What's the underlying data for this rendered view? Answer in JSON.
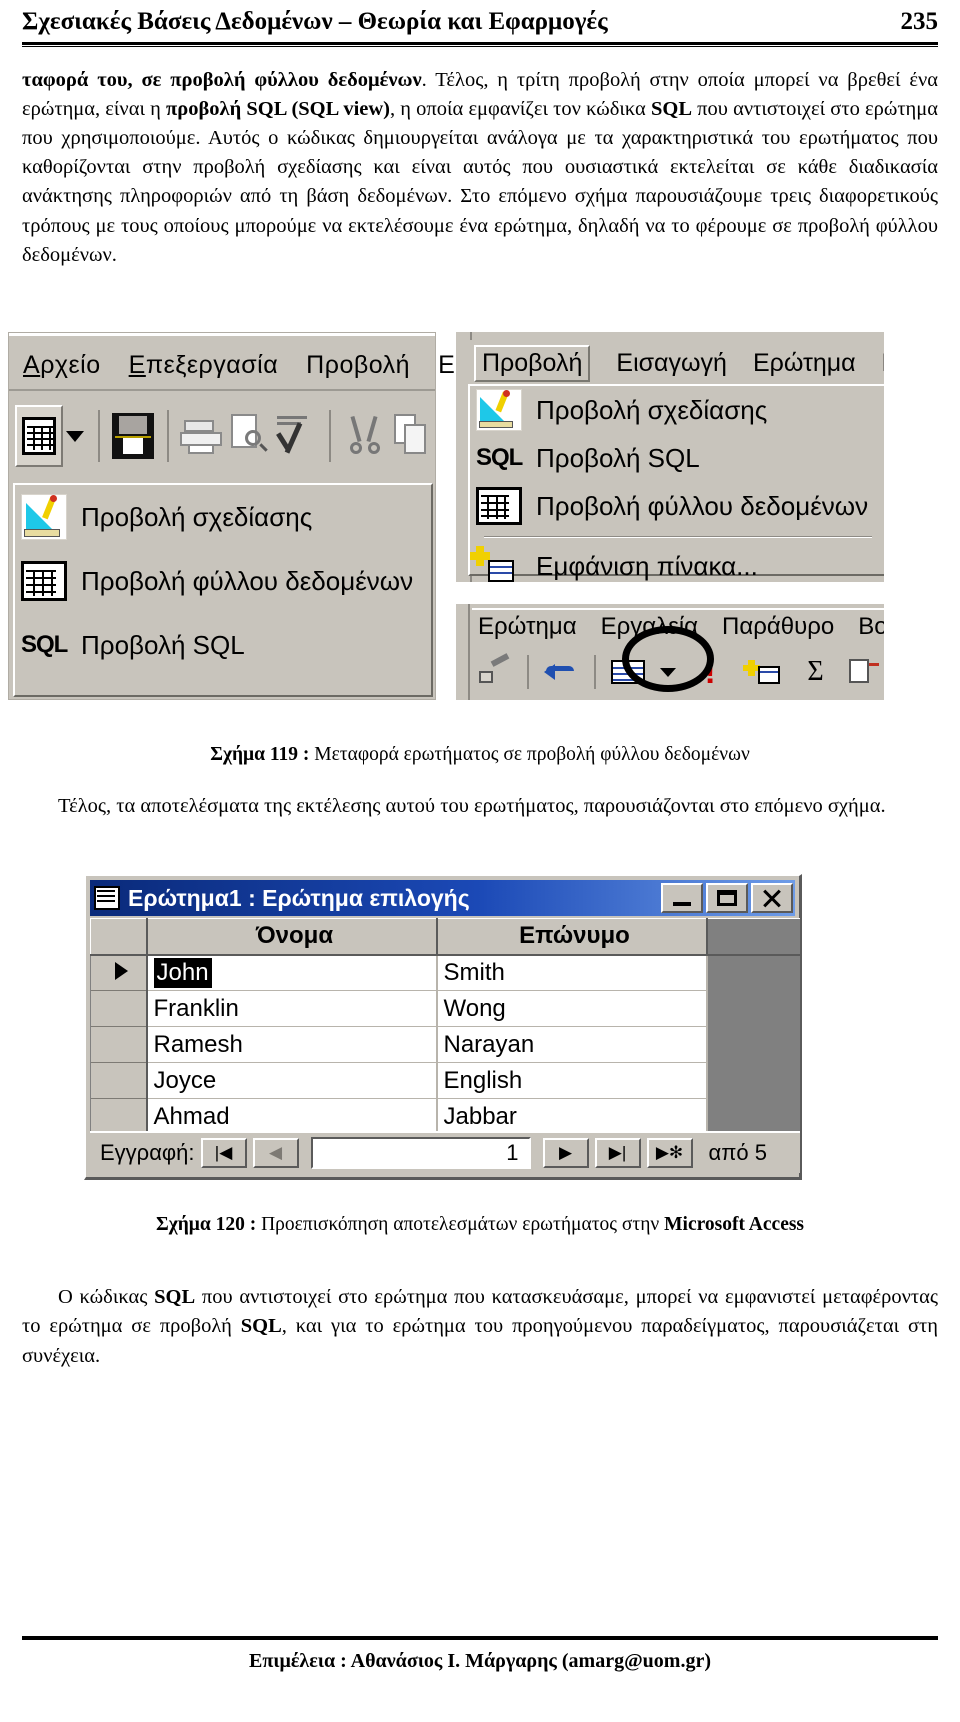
{
  "header": {
    "title": "Σχεσιακές Βάσεις Δεδομένων – Θεωρία και Εφαρμογές",
    "page_number": "235"
  },
  "body": {
    "paragraph1_part1": "ταφορά του, σε προβολή φύλλου δεδομένων",
    "paragraph1_part2": ". Τέλος, η τρίτη προβολή στην οποία μπορεί να βρεθεί ένα ερώτημα, είναι η ",
    "paragraph1_bold2": "προβολή SQL (SQL view)",
    "paragraph1_part3": ", η οποία εμφανίζει τον κώδικα ",
    "paragraph1_bold3": "SQL",
    "paragraph1_part4": " που αντιστοιχεί στο ερώτημα που χρησιμοποιούμε. Αυτός ο κώδικας δημιουργείται ανάλογα με τα χαρακτηριστικά του ερωτήματος που καθορίζονται στην προβολή σχεδίασης και είναι αυτός που ουσιαστικά εκτελείται σε κάθε διαδικασία ανάκτησης πληροφοριών από τη βάση δεδομένων. Στο επόμενο σχήμα παρουσιάζουμε τρεις διαφορετικούς τρόπους με τους οποίους μπορούμε να εκτελέσουμε ένα ερώτημα, δηλαδή να το φέρουμε σε προβολή φύλλου δεδομένων."
  },
  "figure119": {
    "caption_label": "Σχήμα 119 : ",
    "caption_text": "Μεταφορά ερωτήματος σε προβολή φύλλου δεδομένων",
    "left_window": {
      "menus": [
        "Αρχείο",
        "Επεξεργασία",
        "Προβολή",
        "Εισα"
      ],
      "toolbar_icons": [
        "view-datasheet-icon",
        "dropdown-arrow-icon",
        "save-icon",
        "print-icon",
        "print-preview-icon",
        "spelling-icon",
        "cut-icon",
        "copy-icon"
      ],
      "dropdown_items": [
        {
          "label": "Προβολή σχεδίασης",
          "icon": "design-view-icon"
        },
        {
          "label": "Προβολή φύλλου δεδομένων",
          "icon": "datasheet-view-icon"
        },
        {
          "label": "Προβολή SQL",
          "icon": "sql-view-icon"
        }
      ]
    },
    "right_window": {
      "menus": [
        "Προβολή",
        "Εισαγωγή",
        "Ερώτημα",
        "Εργα"
      ],
      "dropdown_items": [
        {
          "label": "Προβολή σχεδίασης",
          "icon": "design-view-icon"
        },
        {
          "label": "Προβολή SQL",
          "icon": "sql-view-icon"
        },
        {
          "label": "Προβολή φύλλου δεδομένων",
          "icon": "datasheet-view-icon"
        },
        {
          "label": "Εμφάνιση πίνακα...",
          "icon": "show-table-icon"
        }
      ]
    },
    "bottom_window": {
      "menus": [
        "Ερώτημα",
        "Εργαλεία",
        "Παράθυρο",
        "Βοή"
      ],
      "toolbar_icons": [
        "format-painter-icon",
        "undo-icon",
        "query-type-icon",
        "run-icon",
        "show-table-icon",
        "totals-icon",
        "properties-icon"
      ],
      "highlight": "run-button-ellipse"
    }
  },
  "after_figure119": {
    "text": "Τέλος, τα αποτελέσματα της εκτέλεσης αυτού του ερωτήματος, παρουσιάζονται στο επόμενο σχήμα."
  },
  "figure120": {
    "caption_label": "Σχήμα 120 : ",
    "caption_text": "Προεπισκόπηση αποτελεσμάτων ερωτήματος στην ",
    "caption_bold_tail": "Microsoft Access",
    "window": {
      "title": "Ερώτημα1 : Ερώτημα επιλογής",
      "title_icon": "query-datasheet-icon",
      "buttons": [
        {
          "name": "minimize",
          "glyph": "_"
        },
        {
          "name": "maximize",
          "glyph": "❐"
        },
        {
          "name": "close",
          "glyph": "✕"
        }
      ],
      "columns": [
        "",
        "Όνομα",
        "Επώνυμο"
      ],
      "rows": [
        {
          "selector": "▶",
          "Όνομα": "John",
          "Επώνυμο": "Smith",
          "selected": true
        },
        {
          "selector": "",
          "Όνομα": "Franklin",
          "Επώνυμο": "Wong",
          "selected": false
        },
        {
          "selector": "",
          "Όνομα": "Ramesh",
          "Επώνυμο": "Narayan",
          "selected": false
        },
        {
          "selector": "",
          "Όνομα": "Joyce",
          "Επώνυμο": "English",
          "selected": false
        },
        {
          "selector": "",
          "Όνομα": "Ahmad",
          "Επώνυμο": "Jabbar",
          "selected": false
        },
        {
          "selector": "✻",
          "Όνομα": "",
          "Επώνυμο": "",
          "selected": false
        }
      ],
      "navigation": {
        "label": "Εγγραφή:",
        "first_glyph": "|◀",
        "prev_glyph": "◀",
        "current_record": "1",
        "next_glyph": "▶",
        "last_glyph": "▶|",
        "new_glyph": "▶✻",
        "total_label": "από 5"
      }
    }
  },
  "final_paragraph": {
    "part1": "Ο κώδικας ",
    "bold1": "SQL",
    "part2": " που αντιστοιχεί στο ερώτημα που κατασκευάσαμε, μπορεί να εμφανιστεί μεταφέροντας το ερώτημα σε προβολή ",
    "bold2": "SQL",
    "part3": ", και για το ερώτημα του προηγούμενου παραδείγματος, παρουσιάζεται στη συνέχεια."
  },
  "footer": {
    "text": "Επιμέλεια : Αθανάσιος Ι. Μάργαρης (amarg@uom.gr)"
  },
  "colors": {
    "window_face": "#c8c4bc",
    "titlebar_start": "#0a2a7a",
    "titlebar_end": "#6e9ce8",
    "grid_background": "#808080",
    "selection": "#000000"
  }
}
